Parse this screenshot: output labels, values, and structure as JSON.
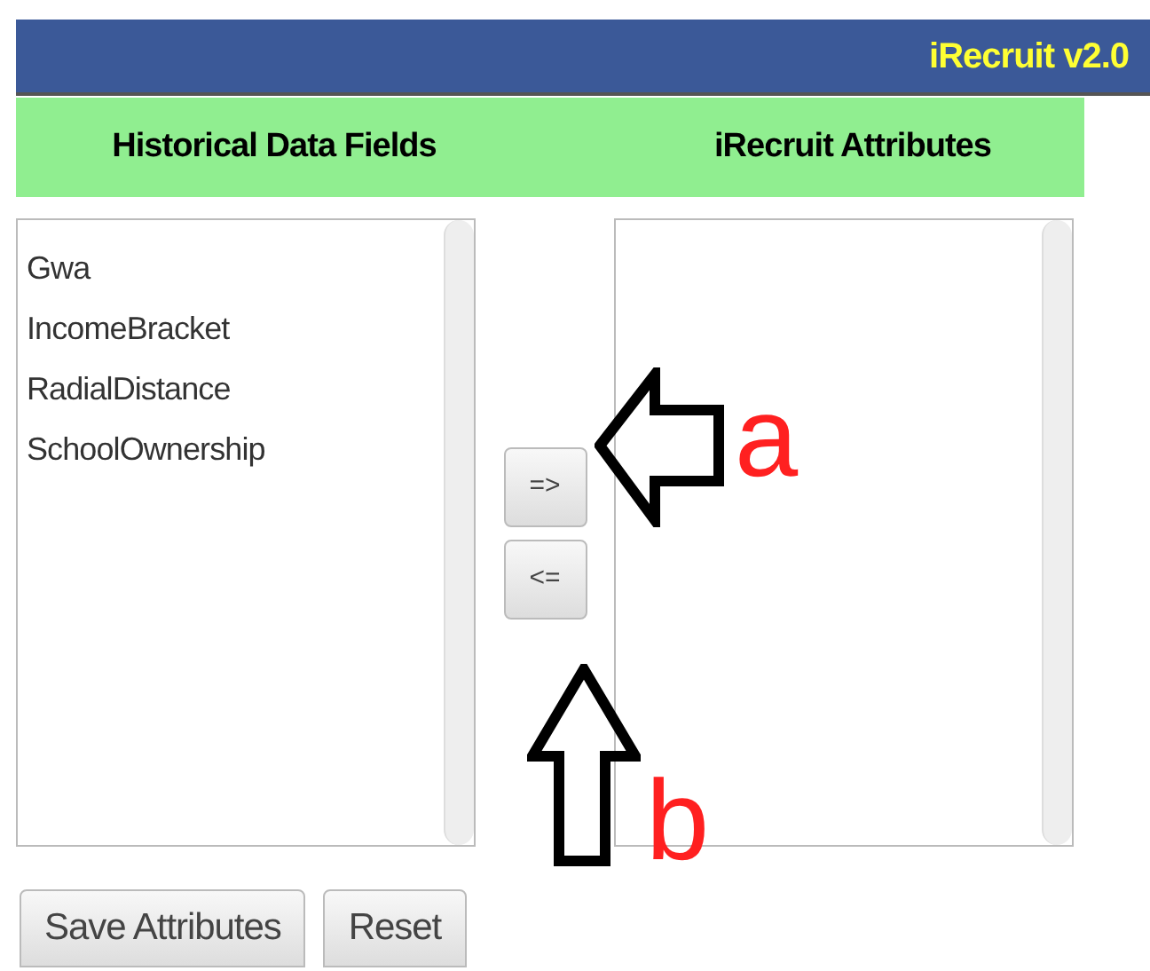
{
  "header": {
    "title": "iRecruit v2.0"
  },
  "columns": [
    {
      "title": "Historical Data Fields"
    },
    {
      "title": "iRecruit Attributes"
    }
  ],
  "left_list": {
    "items": [
      "Gwa",
      "IncomeBracket",
      "RadialDistance",
      "SchoolOwnership"
    ]
  },
  "move_buttons": [
    "=>",
    "<="
  ],
  "buttons": [
    "Save Attributes",
    "Reset"
  ],
  "annotations": [
    {
      "label": "a",
      "kind": "left-arrow"
    },
    {
      "label": "b",
      "kind": "up-arrow"
    }
  ]
}
